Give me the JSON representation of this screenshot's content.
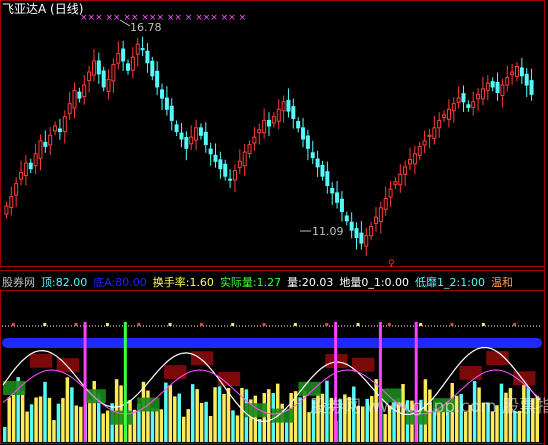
{
  "colors": {
    "up": "#ff3c3c",
    "down": "#54fcfc",
    "frame": "#a00000",
    "title": "#ffffff",
    "marker": "#ff54ff",
    "annotation": "#c0c0c0",
    "band": "#1e28ff",
    "bar_yellow": "#ffea5a",
    "bar_cyan": "#54fcfc",
    "bar_magenta": "#ff40ff",
    "bar_green": "#40ff40",
    "fill_red": "#8a0a0a",
    "fill_green": "#1a8a1a",
    "line_white": "#ffffff",
    "line_pink": "#ff54ff"
  },
  "price_panel": {
    "title": "飞亚达A",
    "period": "(日线)",
    "high_label": "16.78",
    "low_label": "11.09",
    "top_markers": "×××  ××  ××   ×××  ××  ×  ×××  ××  ×"
  },
  "indicator_header": [
    {
      "key": "name",
      "text": "股券网",
      "color": "#c0c0c0"
    },
    {
      "key": "top",
      "text": "顶:82.00",
      "color": "#54fcfc"
    },
    {
      "key": "diA",
      "text": "底A:80.00",
      "color": "#2020ff"
    },
    {
      "key": "turnover",
      "text": "换手率:1.60",
      "color": "#ffff54"
    },
    {
      "key": "actual",
      "text": "实际量:1.27",
      "color": "#40ff40"
    },
    {
      "key": "volume",
      "text": "量:20.03",
      "color": "#ffffff"
    },
    {
      "key": "ground",
      "text": "地量0_1:0.00",
      "color": "#ffffff"
    },
    {
      "key": "low",
      "text": "低靡1_2:1:00",
      "color": "#54fcfc"
    },
    {
      "key": "mild",
      "text": "温和",
      "color": "#ff9c54"
    }
  ],
  "watermark": "股券网  www.gupp.com 股票指标公式大全",
  "chart_data": {
    "type": "candlestick",
    "title": "飞亚达A (日线)",
    "annotations": [
      {
        "text": "16.78",
        "kind": "high"
      },
      {
        "text": "11.09",
        "kind": "low"
      }
    ],
    "close": [
      12.2,
      12.45,
      12.8,
      13.1,
      13.35,
      13.2,
      13.6,
      13.95,
      13.8,
      14.1,
      14.35,
      14.2,
      14.6,
      14.95,
      15.3,
      15.1,
      15.45,
      15.8,
      16.1,
      15.75,
      15.4,
      15.6,
      16.0,
      16.3,
      16.1,
      15.85,
      16.2,
      16.55,
      16.4,
      16.05,
      15.7,
      15.4,
      15.1,
      14.8,
      14.5,
      14.2,
      14.0,
      13.75,
      14.05,
      14.3,
      14.1,
      13.85,
      13.6,
      13.4,
      13.2,
      13.0,
      12.9,
      13.15,
      13.4,
      13.65,
      13.85,
      14.05,
      14.25,
      14.5,
      14.35,
      14.6,
      14.8,
      15.0,
      14.75,
      14.55,
      14.3,
      14.0,
      13.75,
      13.5,
      13.25,
      13.0,
      12.75,
      12.55,
      12.3,
      12.05,
      11.8,
      11.55,
      11.35,
      11.2,
      11.4,
      11.65,
      11.9,
      12.15,
      12.4,
      12.65,
      12.85,
      13.05,
      13.25,
      13.45,
      13.6,
      13.8,
      13.95,
      14.1,
      14.3,
      14.5,
      14.65,
      14.8,
      14.95,
      15.1,
      15.0,
      14.85,
      15.0,
      15.2,
      15.35,
      15.5,
      15.4,
      15.25,
      15.45,
      15.65,
      15.8,
      15.95,
      15.7,
      15.45,
      15.2
    ],
    "ylim": [
      10.8,
      17.2
    ],
    "indicator": {
      "top": 82.0,
      "diA": 80.0,
      "turnover": 1.6,
      "actual_volume": 1.27,
      "volume": 20.03
    }
  }
}
